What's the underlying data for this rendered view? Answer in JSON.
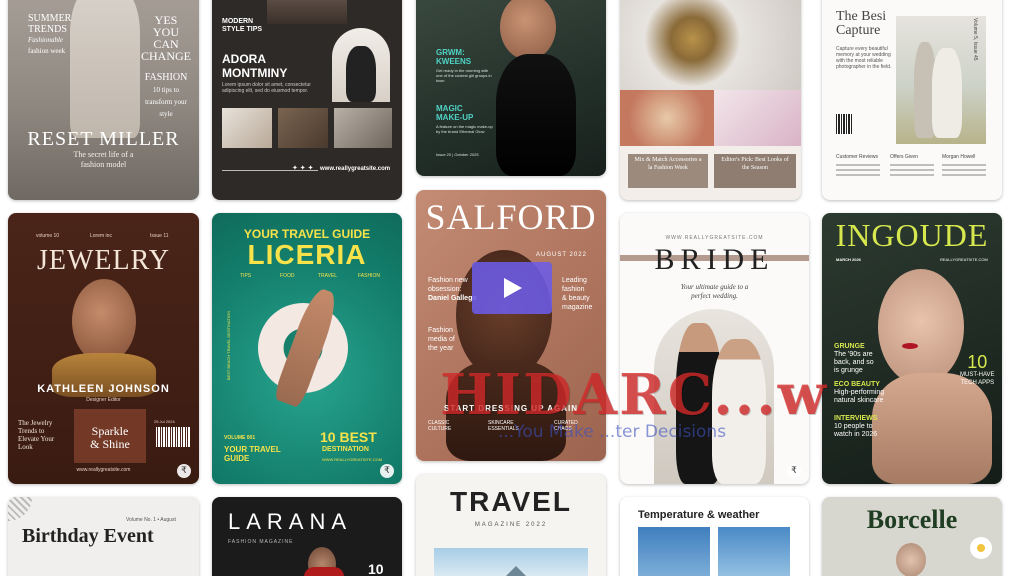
{
  "cards": {
    "c1": {
      "t1": "SUMMER",
      "t2": "TRENDS",
      "t3": "Fashionable",
      "t4": "fashion week",
      "t5": "YES",
      "t6": "YOU",
      "t7": "CAN",
      "t8": "CHANGE",
      "t9": "FASHION",
      "t10": "10 tips to",
      "t11": "transform your",
      "t12": "style",
      "name": "RESET MILLER",
      "sub1": "The secret life of a",
      "sub2": "fashion model"
    },
    "c2": {
      "kicker1": "MODERN",
      "kicker2": "STYLE TIPS",
      "name1": "ADORA",
      "name2": "MONTMINY",
      "body": "Lorem ipsum dolor sit amet, consectetur adipiscing elit, sed do eiusmod tempor.",
      "stars": "✦ ✦ ✦",
      "site": "www.reallygreatsite.com"
    },
    "c3": {
      "h1": "GRWM:",
      "h2": "KWEENS",
      "p1": "Get ready in the morning with one of the coolest girl groups in town",
      "h3": "MAGIC",
      "h4": "MAKE-UP",
      "p2": "A feature on the magic make-up by the brand Ethereal Glow",
      "issue": "Issue 20 | October 2025"
    },
    "c4": {
      "cap1": "Mix & Match Accessories a la Fashion Week",
      "cap2": "Editor's Pick: Best Looks of the Season"
    },
    "c5": {
      "title1": "The Besi",
      "title2": "Capture",
      "intro": "Capture every beautiful memory at your wedding with the most reliable photographer in the field.",
      "vol": "Volume 5, Issue 45",
      "col1": "Customer Reviews",
      "col2": "Offers Given",
      "col3": "Morgan Howell"
    },
    "c6": {
      "vol": "volume 10",
      "mid": "Lorem inc",
      "issue": "Issue 11",
      "title": "JEWELRY",
      "name": "KATHLEEN JOHNSON",
      "role": "Designer Editor",
      "left1": "The Jewelry",
      "left2": "Trends to",
      "left3": "Elevate Your",
      "left4": "Look",
      "mid1": "Sparkle",
      "mid2": "& Shine",
      "date": "25 Jul 2024",
      "site": "www.reallygreatsite.com"
    },
    "c7": {
      "kicker": "YOUR TRAVEL GUIDE",
      "title": "LICERIA",
      "tabs": [
        "TIPS",
        "FOOD",
        "TRAVEL",
        "FASHION"
      ],
      "vol": "VOLUME 001",
      "guide1": "YOUR TRAVEL",
      "guide2": "GUIDE",
      "best1": "10 BEST",
      "best2": "DESTINATION",
      "site": "WWW.REALLYGREATSITE.COM",
      "side": "BEST BEACH TRAVEL DESTINATION"
    },
    "c8": {
      "title": "SALFORD",
      "date": "AUGUST 2022",
      "l1": "Fashion new",
      "l2": "obsession:",
      "l3": "Daniel Gallego",
      "l4": "Fashion",
      "l5": "media of",
      "l6": "the year",
      "r1": "Leading",
      "r2": "fashion",
      "r3": "& beauty",
      "r4": "magazine",
      "banner": "START DRESSING UP AGAIN",
      "b1": "CLASSIC CULTURE",
      "b2": "SKINCARE ESSENTIALS",
      "b3": "CURATED CHAOS"
    },
    "c9": {
      "site": "WWW.REALLYGREATSITE.COM",
      "title": "BRIDE",
      "sub1": "Your ultimate guide to a",
      "sub2": "perfect wedding."
    },
    "c10": {
      "title": "INGOUDE",
      "date": "MARCH 2026",
      "site": "REALLYGREATSITE.COM",
      "g1": "GRUNGE",
      "g2": "The '90s are",
      "g3": "back, and so",
      "g4": "is grunge",
      "e1": "ECO BEAUTY",
      "e2": "High-performing",
      "e3": "natural skincare",
      "i1": "INTERVIEWS",
      "i2": "10 people to",
      "i3": "watch in 2026",
      "n1": "10",
      "n2": "MUST-HAVE",
      "n3": "TECH APPS"
    },
    "c11": {
      "vol": "Volume No. 1 • August",
      "title": "Birthday Event"
    },
    "c12": {
      "title": "LARANA",
      "sub": "FASHION MAGAZINE",
      "num": "10"
    },
    "c13": {
      "title": "TRAVEL",
      "sub": "MAGAZINE 2022"
    },
    "c14": {
      "title": "Temperature & weather"
    },
    "c15": {
      "title": "Borcelle"
    }
  },
  "watermark": {
    "line1": "HIDARC...w",
    "line2": "...You Make ...ter Decisions"
  },
  "premium_glyph": "₹",
  "icons": {
    "play": "play-icon",
    "premium": "premium-crown-icon"
  }
}
